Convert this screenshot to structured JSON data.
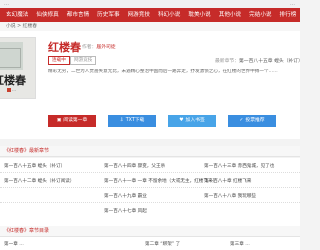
{
  "topbar": {
    "left": "…",
    "right": "…"
  },
  "nav": [
    "玄幻魔法",
    "仙侠修真",
    "都市言情",
    "历史军事",
    "网游竞技",
    "科幻小说",
    "耽美小说",
    "其他小说",
    "完结小说",
    "排行榜"
  ],
  "breadcrumb": "小说  >  红楼春",
  "book": {
    "title": "红楼春",
    "author_label": "作者：",
    "author": "届外司徒",
    "tags": [
      "连载中",
      "网游竞技"
    ],
    "latest_label": "最新章节：",
    "latest": "第一百八十五章 蝗头（补订）",
    "description": "精彩无穷，二世为人贾蔷失意无比，未遇精心整治中国而后一路奔走，抒发激愤之心，在红楼的世界中搏一个……"
  },
  "buttons": {
    "read": "阅读第一章",
    "txt": "TXT下载",
    "bookmark": "加入书签",
    "vote": "投票推荐"
  },
  "sections": {
    "latest_title": "《红楼春》最新章节",
    "all_title": "《红楼春》章节目录"
  },
  "latest_chapters": [
    "第一百八十五章 蝗头（补订）",
    "第一百八十四章 骤变，父王杀",
    "第一百八十三章 赤西鬼城，见了也",
    "第一百八十二章 蝗头（补订阅读）",
    "第一百八十一章 一章 不留余地（大或无主，红楼飞来）",
    "第一百八十章 红楼飞来",
    "第一百八十九章 霸业",
    "第一百八十八章 我玩哪些",
    "第一百八十七章 风起"
  ],
  "all_chapters": [
    "第一章 …",
    "第二章 “绑架” 了",
    "第三章 …"
  ]
}
